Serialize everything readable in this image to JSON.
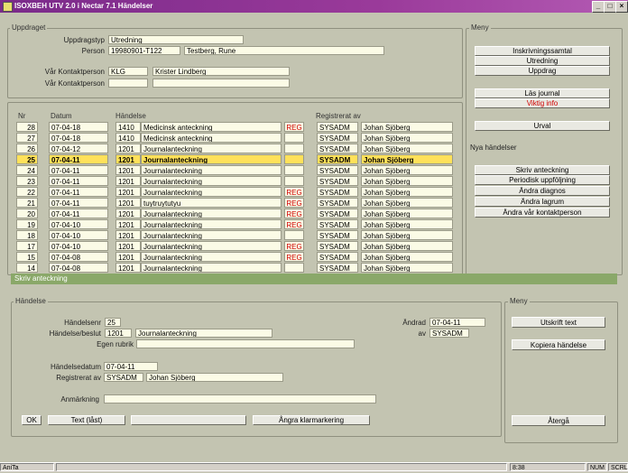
{
  "window": {
    "title": "ISOXBEH UTV 2.0 i Nectar 7.1   Händelser",
    "min": "_",
    "max": "□",
    "close": "×"
  },
  "uppdraget": {
    "group_label": "Uppdraget",
    "uppdragstyp_label": "Uppdragstyp",
    "uppdragstyp": "Utredning",
    "person_label": "Person",
    "person_id": "19980901-T122",
    "person_name": "Testberg, Rune",
    "kontakt1_label": "Vår Kontaktperson",
    "kontakt1_code": "KLG",
    "kontakt1_name": "Krister Lindberg",
    "kontakt2_label": "Vår Kontaktperson",
    "kontakt2_code": "",
    "kontakt2_name": ""
  },
  "table": {
    "headers": {
      "nr": "Nr",
      "datum": "Datum",
      "handelse": "Händelse",
      "registrerat": "Registrerat av"
    },
    "rows": [
      {
        "nr": "28",
        "datum": "07-04-18",
        "code": "1410",
        "text": "Medicinsk anteckning",
        "reg": "REG",
        "user": "SYSADM",
        "name": "Johan Sjöberg"
      },
      {
        "nr": "27",
        "datum": "07-04-18",
        "code": "1410",
        "text": "Medicinsk anteckning",
        "reg": "",
        "user": "SYSADM",
        "name": "Johan Sjöberg"
      },
      {
        "nr": "26",
        "datum": "07-04-12",
        "code": "1201",
        "text": "Journalanteckning",
        "reg": "",
        "user": "SYSADM",
        "name": "Johan Sjöberg"
      },
      {
        "nr": "25",
        "datum": "07-04-11",
        "code": "1201",
        "text": "Journalanteckning",
        "reg": "",
        "user": "SYSADM",
        "name": "Johan Sjöberg",
        "selected": true
      },
      {
        "nr": "24",
        "datum": "07-04-11",
        "code": "1201",
        "text": "Journalanteckning",
        "reg": "",
        "user": "SYSADM",
        "name": "Johan Sjöberg"
      },
      {
        "nr": "23",
        "datum": "07-04-11",
        "code": "1201",
        "text": "Journalanteckning",
        "reg": "",
        "user": "SYSADM",
        "name": "Johan Sjöberg"
      },
      {
        "nr": "22",
        "datum": "07-04-11",
        "code": "1201",
        "text": "Journalanteckning",
        "reg": "REG",
        "user": "SYSADM",
        "name": "Johan Sjöberg"
      },
      {
        "nr": "21",
        "datum": "07-04-11",
        "code": "1201",
        "text": "tuytruytutyu",
        "reg": "REG",
        "user": "SYSADM",
        "name": "Johan Sjöberg"
      },
      {
        "nr": "20",
        "datum": "07-04-11",
        "code": "1201",
        "text": "Journalanteckning",
        "reg": "REG",
        "user": "SYSADM",
        "name": "Johan Sjöberg"
      },
      {
        "nr": "19",
        "datum": "07-04-10",
        "code": "1201",
        "text": "Journalanteckning",
        "reg": "REG",
        "user": "SYSADM",
        "name": "Johan Sjöberg"
      },
      {
        "nr": "18",
        "datum": "07-04-10",
        "code": "1201",
        "text": "Journalanteckning",
        "reg": "",
        "user": "SYSADM",
        "name": "Johan Sjöberg"
      },
      {
        "nr": "17",
        "datum": "07-04-10",
        "code": "1201",
        "text": "Journalanteckning",
        "reg": "REG",
        "user": "SYSADM",
        "name": "Johan Sjöberg"
      },
      {
        "nr": "15",
        "datum": "07-04-08",
        "code": "1201",
        "text": "Journalanteckning",
        "reg": "REG",
        "user": "SYSADM",
        "name": "Johan Sjöberg"
      },
      {
        "nr": "14",
        "datum": "07-04-08",
        "code": "1201",
        "text": "Journalanteckning",
        "reg": "",
        "user": "SYSADM",
        "name": "Johan Sjöberg"
      }
    ]
  },
  "meny": {
    "group_label": "Meny",
    "inskrivning": "Inskrivningssamtal",
    "utredning": "Utredning",
    "uppdrag": "Uppdrag",
    "las_journal": "Läs journal",
    "viktig_info": "Viktig info",
    "urval": "Urval",
    "nya_label": "Nya händelser",
    "skriv": "Skriv anteckning",
    "periodisk": "Periodisk uppföljning",
    "andra_diagnos": "Ändra diagnos",
    "andra_lagrum": "Ändra lagrum",
    "andra_kontakt": "Ändra vår kontaktperson"
  },
  "skriv": {
    "title": "Skriv anteckning",
    "group_label": "Händelse",
    "handelsenr_label": "Händelsenr",
    "handelsenr": "25",
    "handelse_label": "Händelse/beslut",
    "handelse_code": "1201",
    "handelse_text": "Journalanteckning",
    "rubrik_label": "Egen rubrik",
    "rubrik": "",
    "andrad_label": "Ändrad",
    "andrad": "07-04-11",
    "av_label": "av",
    "av": "SYSADM",
    "datum_label": "Händelsedatum",
    "datum": "07-04-11",
    "reg_label": "Registrerat av",
    "reg_user": "SYSADM",
    "reg_name": "Johan Sjöberg",
    "anm_label": "Anmärkning",
    "anm": "",
    "ok": "OK",
    "text_last": "Text (låst)",
    "blank": "",
    "angra": "Ångra klarmarkering"
  },
  "meny2": {
    "group_label": "Meny",
    "utskrift": "Utskrift text",
    "kopiera": "Kopiera händelse",
    "atergå": "Återgå"
  },
  "status": {
    "left": "AniTa",
    "time": "8:38",
    "num": "NUM",
    "scrl": "SCRL"
  }
}
